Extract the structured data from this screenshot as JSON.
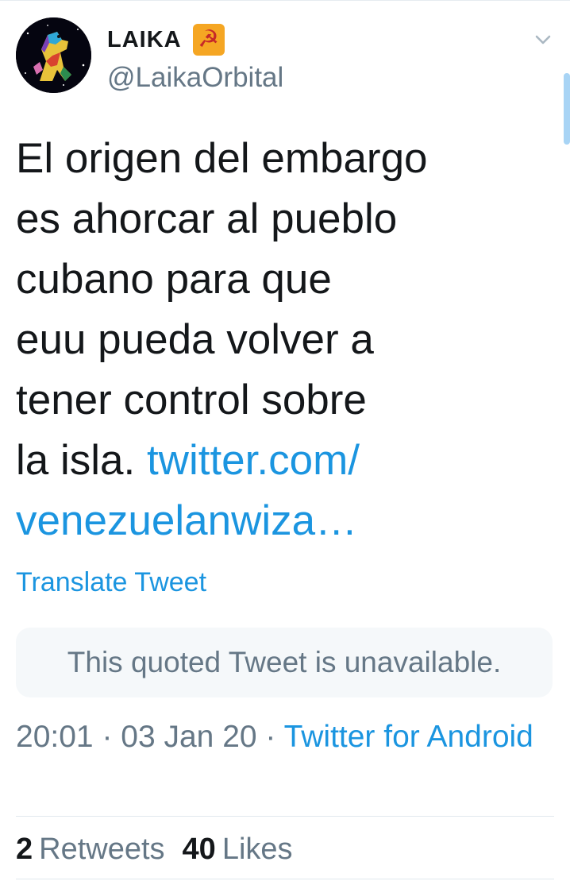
{
  "author": {
    "display_name": "LAIKA",
    "badge_emoji": "☭",
    "handle": "@LaikaOrbital"
  },
  "tweet": {
    "lines": [
      "El origen del embargo",
      "es ahorcar al pueblo",
      "cubano para que",
      "euu pueda volver a",
      "tener control sobre"
    ],
    "last_line_text": "la isla. ",
    "link_part1": "twitter.com/",
    "link_part2": "venezuelanwiza…"
  },
  "translate_label": "Translate Tweet",
  "quoted": {
    "text": "This quoted Tweet is unavailable."
  },
  "meta": {
    "time": "20:01",
    "separator1": " · ",
    "date": "03 Jan 20",
    "separator2": " · ",
    "client": "Twitter for Android"
  },
  "stats": {
    "retweets_count": "2",
    "retweets_label": "Retweets",
    "likes_count": "40",
    "likes_label": "Likes"
  },
  "icons": {
    "caret": "chevron-down-icon",
    "avatar": "avatar"
  },
  "colors": {
    "link": "#1b95e0",
    "secondary_text": "#657786",
    "primary_text": "#14171a",
    "quote_background": "#f5f8fa"
  }
}
